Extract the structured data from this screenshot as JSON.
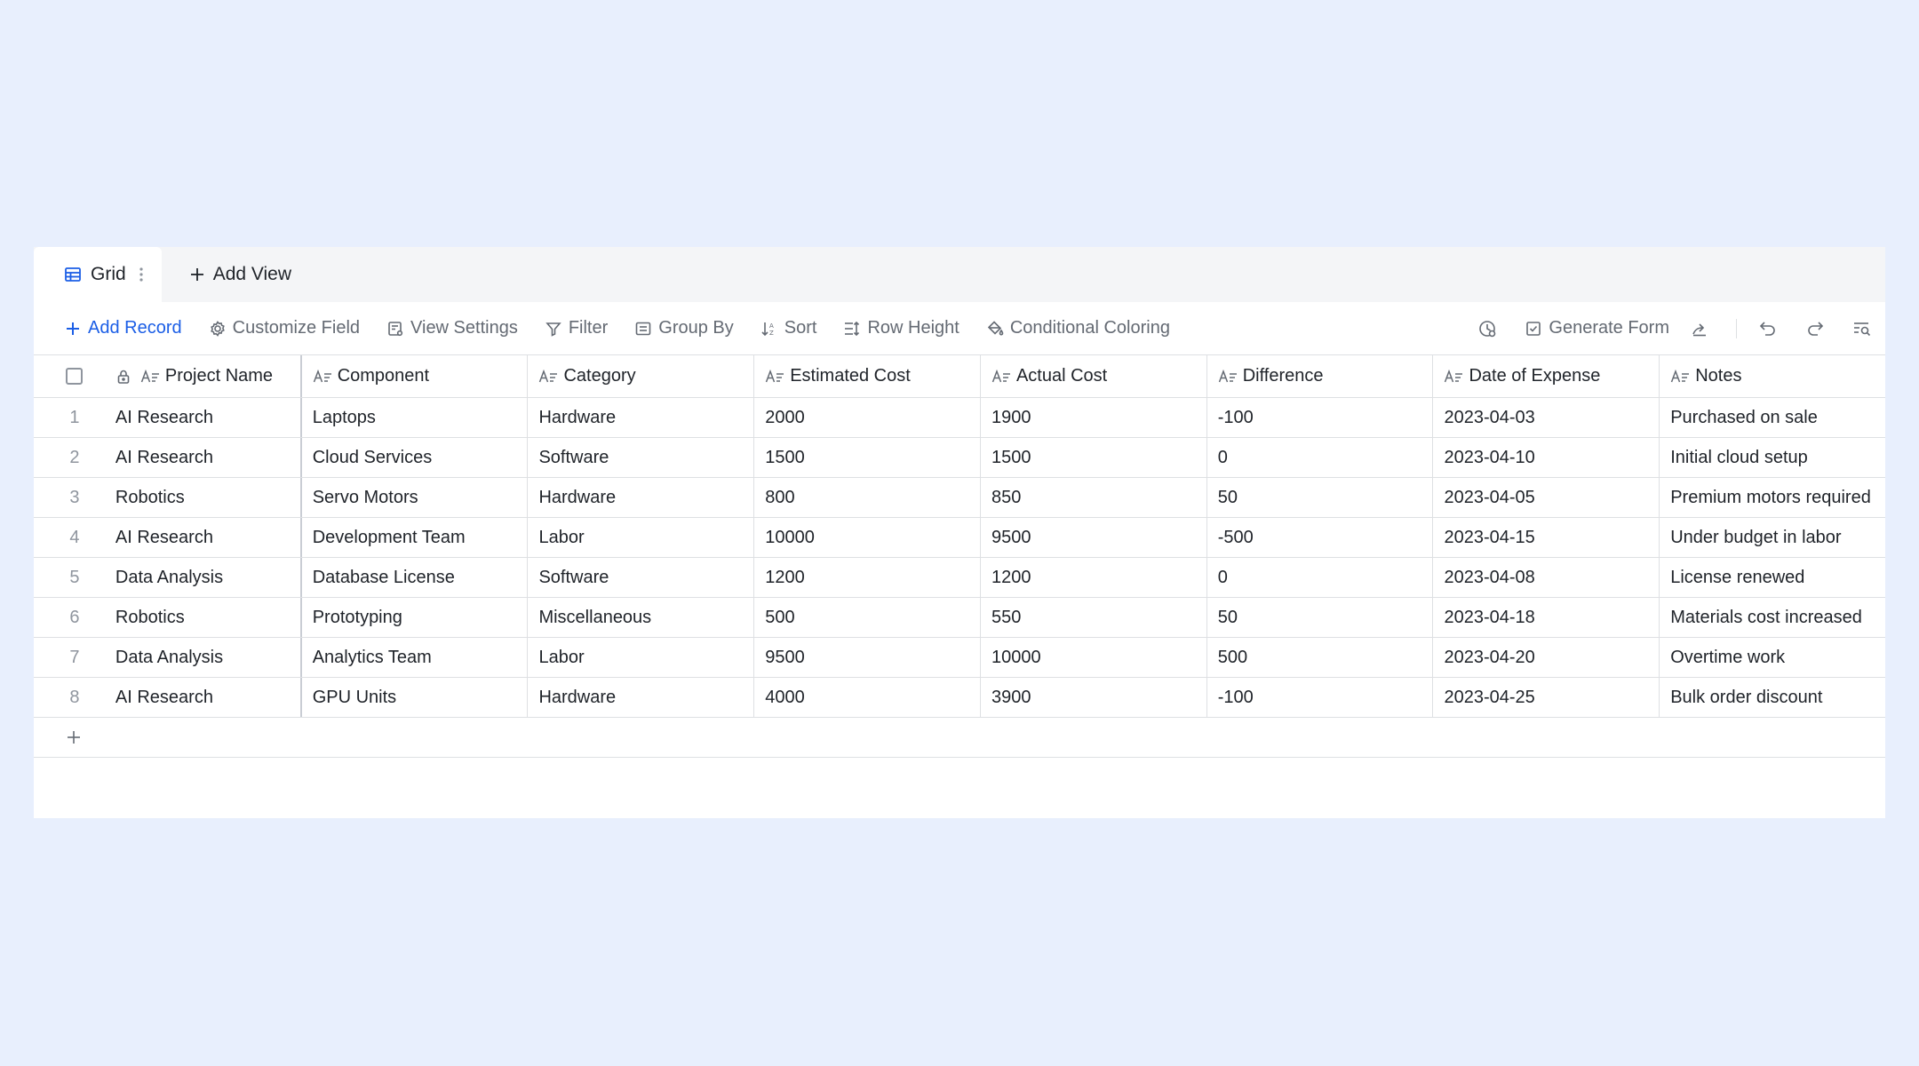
{
  "tabs": {
    "active_label": "Grid",
    "add_view_label": "Add View"
  },
  "toolbar": {
    "add_record": "Add Record",
    "customize_field": "Customize Field",
    "view_settings": "View Settings",
    "filter": "Filter",
    "group_by": "Group By",
    "sort": "Sort",
    "row_height": "Row Height",
    "conditional_coloring": "Conditional Coloring",
    "generate_form": "Generate Form"
  },
  "columns": [
    "Project Name",
    "Component",
    "Category",
    "Estimated Cost",
    "Actual Cost",
    "Difference",
    "Date of Expense",
    "Notes"
  ],
  "rows": [
    {
      "index": "1",
      "project": "AI Research",
      "component": "Laptops",
      "category": "Hardware",
      "estimated": "2000",
      "actual": "1900",
      "difference": "-100",
      "date": "2023-04-03",
      "notes": "Purchased on sale"
    },
    {
      "index": "2",
      "project": "AI Research",
      "component": "Cloud Services",
      "category": "Software",
      "estimated": "1500",
      "actual": "1500",
      "difference": "0",
      "date": "2023-04-10",
      "notes": "Initial cloud setup"
    },
    {
      "index": "3",
      "project": "Robotics",
      "component": "Servo Motors",
      "category": "Hardware",
      "estimated": "800",
      "actual": "850",
      "difference": "50",
      "date": "2023-04-05",
      "notes": "Premium motors required"
    },
    {
      "index": "4",
      "project": "AI Research",
      "component": "Development Team",
      "category": "Labor",
      "estimated": "10000",
      "actual": "9500",
      "difference": "-500",
      "date": "2023-04-15",
      "notes": "Under budget in labor"
    },
    {
      "index": "5",
      "project": "Data Analysis",
      "component": "Database License",
      "category": "Software",
      "estimated": "1200",
      "actual": "1200",
      "difference": "0",
      "date": "2023-04-08",
      "notes": "License renewed"
    },
    {
      "index": "6",
      "project": "Robotics",
      "component": "Prototyping",
      "category": "Miscellaneous",
      "estimated": "500",
      "actual": "550",
      "difference": "50",
      "date": "2023-04-18",
      "notes": "Materials cost increased"
    },
    {
      "index": "7",
      "project": "Data Analysis",
      "component": "Analytics Team",
      "category": "Labor",
      "estimated": "9500",
      "actual": "10000",
      "difference": "500",
      "date": "2023-04-20",
      "notes": "Overtime work"
    },
    {
      "index": "8",
      "project": "AI Research",
      "component": "GPU Units",
      "category": "Hardware",
      "estimated": "4000",
      "actual": "3900",
      "difference": "-100",
      "date": "2023-04-25",
      "notes": "Bulk order discount"
    }
  ],
  "colors": {
    "accent": "#1b5ee6",
    "background": "#e8effd",
    "border": "#dee0e3"
  },
  "icons": [
    "grid-icon",
    "more-icon",
    "plus-icon",
    "gear-icon",
    "view-settings-icon",
    "filter-icon",
    "group-by-icon",
    "sort-icon",
    "row-height-icon",
    "paint-bucket-icon",
    "history-icon",
    "form-icon",
    "share-icon",
    "undo-icon",
    "redo-icon",
    "search-records-icon",
    "lock-icon",
    "text-field-icon"
  ]
}
